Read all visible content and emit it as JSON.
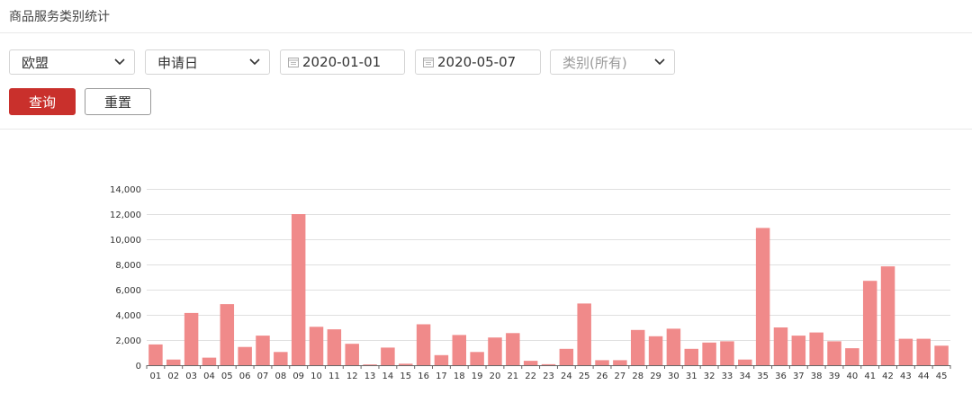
{
  "header": {
    "title": "商品服务类别统计"
  },
  "filters": {
    "region": "欧盟",
    "date_type": "申请日",
    "start_date": "2020-01-01",
    "end_date": "2020-05-07",
    "category_placeholder": "类别(所有)"
  },
  "buttons": {
    "query": "查询",
    "reset": "重置"
  },
  "colors": {
    "bar": "#f08a8a",
    "primary": "#c9302c"
  },
  "chart_data": {
    "type": "bar",
    "categories": [
      "01",
      "02",
      "03",
      "04",
      "05",
      "06",
      "07",
      "08",
      "09",
      "10",
      "11",
      "12",
      "13",
      "14",
      "15",
      "16",
      "17",
      "18",
      "19",
      "20",
      "21",
      "22",
      "23",
      "24",
      "25",
      "26",
      "27",
      "28",
      "29",
      "30",
      "31",
      "32",
      "33",
      "34",
      "35",
      "36",
      "37",
      "38",
      "39",
      "40",
      "41",
      "42",
      "43",
      "44",
      "45"
    ],
    "values": [
      1650,
      450,
      4150,
      600,
      4850,
      1450,
      2350,
      1050,
      12000,
      3050,
      2850,
      1700,
      60,
      1400,
      120,
      3250,
      800,
      2400,
      1050,
      2200,
      2550,
      350,
      80,
      1300,
      4900,
      400,
      400,
      2800,
      2300,
      2900,
      1300,
      1800,
      1900,
      450,
      10900,
      3000,
      2350,
      2600,
      1900,
      1350,
      6700,
      7850,
      2100,
      2100,
      1550
    ],
    "ylim": [
      0,
      14000
    ],
    "yticks": [
      "0",
      "2,000",
      "4,000",
      "6,000",
      "8,000",
      "10,000",
      "12,000",
      "14,000"
    ],
    "grid": true
  }
}
